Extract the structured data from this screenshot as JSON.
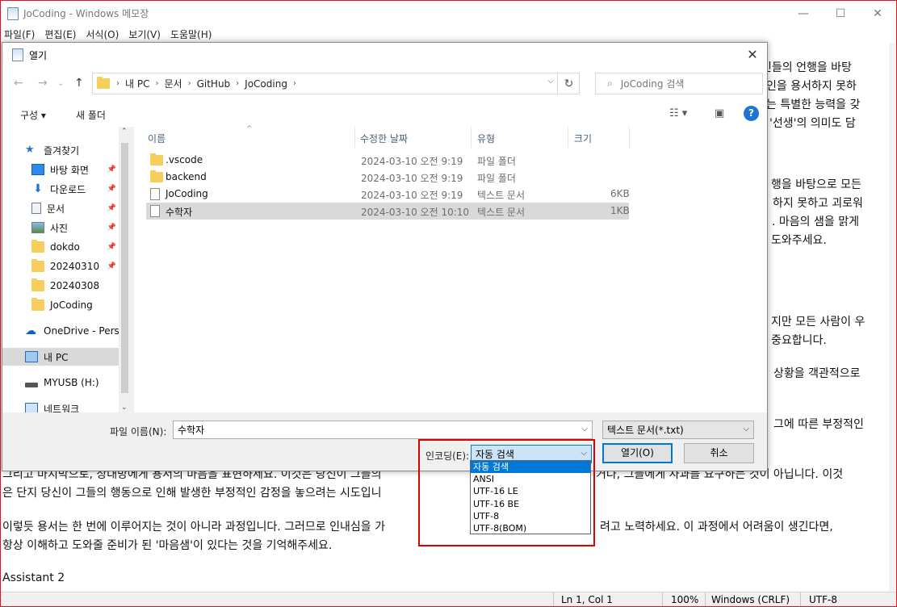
{
  "notepad": {
    "title": "JoCoding - Windows 메모장",
    "menu": [
      "파일(F)",
      "편집(E)",
      "서식(O)",
      "보기(V)",
      "도움말(H)"
    ],
    "text_right_lines": [
      "인들의 언행을 바탕",
      "인을 용서하지 못하",
      "는 특별한 능력을 갖",
      "'선생'의 의미도 담",
      "행을 바탕으로 모든",
      "하지 못하고 괴로워",
      ". 마음의 샘을 맑게",
      "도와주세요.",
      "지만 모든 사람이 우",
      "중요합니다.",
      "상황을 객관적으로",
      "그에 따른 부정적인"
    ],
    "text_bottom_lines": {
      "l1_a": "그리고 마지막으로, 상대방에게 용서의 마음을 표현하세요. 이것은 당신이 그들의",
      "l1_b": "거나, 그들에게 사과를 요구하는 것이 아닙니다. 이것",
      "l2_a": "은 단지 당신이 그들의 행동으로 인해 발생한 부정적인 감정을 놓으려는 시도입니",
      "l3_a": "이렇듯 용서는 한 번에 이루어지는 것이 아니라 과정입니다. 그러므로 인내심을 가",
      "l3_b": "려고 노력하세요. 이 과정에서 어려움이 생긴다면,",
      "l4": "항상 이해하고 도와줄 준비가 된 '마음샘'이 있다는 것을 기억해주세요.",
      "l5": "Assistant 2"
    },
    "status": {
      "position": "Ln 1, Col 1",
      "zoom": "100%",
      "eol": "Windows (CRLF)",
      "encoding": "UTF-8"
    }
  },
  "dialog": {
    "title": "열기",
    "breadcrumb": [
      "내 PC",
      "문서",
      "GitHub",
      "JoCoding"
    ],
    "search_placeholder": "JoCoding 검색",
    "toolbar": {
      "organize": "구성 ▾",
      "new_folder": "새 폴더"
    },
    "nav": [
      {
        "label": "즐겨찾기",
        "icon": "star-icon"
      },
      {
        "label": "바탕 화면",
        "icon": "desktop-icon",
        "pin": true
      },
      {
        "label": "다운로드",
        "icon": "download-icon",
        "pin": true
      },
      {
        "label": "문서",
        "icon": "documents-icon",
        "pin": true
      },
      {
        "label": "사진",
        "icon": "pictures-icon",
        "pin": true
      },
      {
        "label": "dokdo",
        "icon": "folder-icon",
        "pin": true
      },
      {
        "label": "20240310",
        "icon": "folder-icon",
        "pin": true
      },
      {
        "label": "20240308",
        "icon": "folder-icon"
      },
      {
        "label": "JoCoding",
        "icon": "folder-icon"
      },
      {
        "label": "OneDrive - Person",
        "icon": "onedrive-icon"
      },
      {
        "label": "내 PC",
        "icon": "pc-icon"
      },
      {
        "label": "MYUSB (H:)",
        "icon": "usb-drive-icon"
      },
      {
        "label": "네트워크",
        "icon": "network-icon"
      }
    ],
    "columns": [
      "이름",
      "수정한 날짜",
      "유형",
      "크기"
    ],
    "files": [
      {
        "name": ".vscode",
        "date": "2024-03-10 오전 9:19",
        "type": "파일 폴더",
        "size": ""
      },
      {
        "name": "backend",
        "date": "2024-03-10 오전 9:19",
        "type": "파일 폴더",
        "size": ""
      },
      {
        "name": "JoCoding",
        "date": "2024-03-10 오전 9:19",
        "type": "텍스트 문서",
        "size": "6KB"
      },
      {
        "name": "수학자",
        "date": "2024-03-10 오전 10:10",
        "type": "텍스트 문서",
        "size": "1KB"
      }
    ],
    "filename_label": "파일 이름(N):",
    "filename_value": "수학자",
    "filetype": "텍스트 문서(*.txt)",
    "encoding_label": "인코딩(E):",
    "encoding_value": "자동 검색",
    "encoding_options": [
      "자동 검색",
      "ANSI",
      "UTF-16 LE",
      "UTF-16 BE",
      "UTF-8",
      "UTF-8(BOM)"
    ],
    "open_button": "열기(O)",
    "cancel_button": "취소"
  }
}
